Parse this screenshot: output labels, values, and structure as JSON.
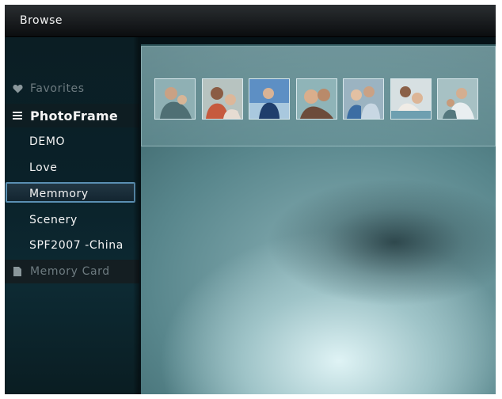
{
  "header": {
    "title": "Browse"
  },
  "sidebar": {
    "items": [
      {
        "label": "Favorites",
        "icon": "heart-icon",
        "state": "disabled"
      },
      {
        "label": "PhotoFrame",
        "icon": "list-icon",
        "state": "header"
      },
      {
        "label": "DEMO",
        "state": "normal"
      },
      {
        "label": "Love",
        "state": "normal"
      },
      {
        "label": "Memmory",
        "state": "selected"
      },
      {
        "label": "Scenery",
        "state": "normal"
      },
      {
        "label": "SPF2007 -China",
        "state": "normal"
      },
      {
        "label": "Memory Card",
        "icon": "memory-card-icon",
        "state": "disabled"
      }
    ]
  },
  "thumbnails": {
    "count": 7,
    "colors": [
      "#6f8f94",
      "#9c7866",
      "#4f7aa6",
      "#a28a72",
      "#7f98a8",
      "#b49a84",
      "#6c8c86"
    ]
  },
  "colors": {
    "selection_border": "#5a8fb2",
    "background_dark": "#061217"
  }
}
